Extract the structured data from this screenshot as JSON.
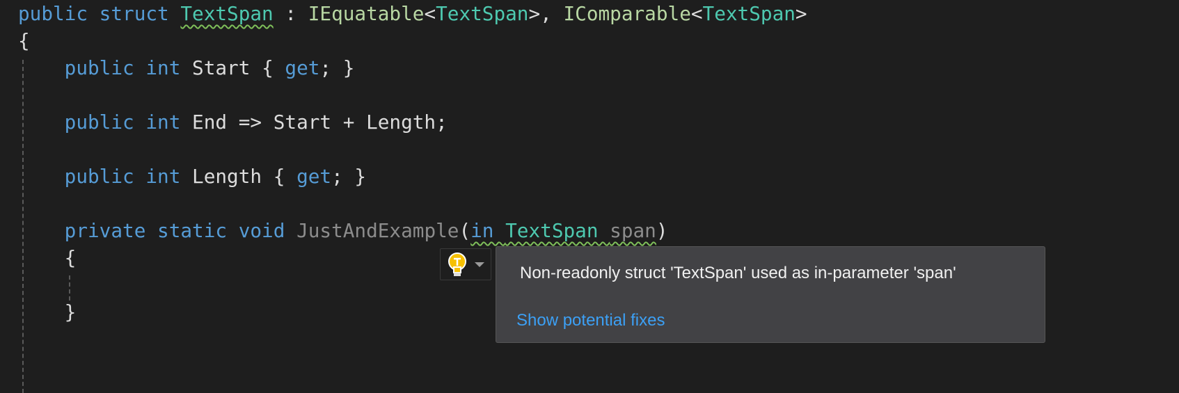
{
  "colors": {
    "background": "#1e1e1e",
    "keyword": "#569cd6",
    "type": "#4ec9b0",
    "interface": "#b8d7a3",
    "text": "#dcdcdc",
    "unused": "#8c8c8c",
    "squiggle": "#7fbf5a",
    "link": "#3ca0f5"
  },
  "code": {
    "lines": [
      [
        {
          "t": "public struct ",
          "c": "kw"
        },
        {
          "t": "TextSpan",
          "c": "ty sq"
        },
        {
          "t": " : ",
          "c": "tx"
        },
        {
          "t": "IEquatable",
          "c": "if"
        },
        {
          "t": "<",
          "c": "tx"
        },
        {
          "t": "TextSpan",
          "c": "ty"
        },
        {
          "t": ">, ",
          "c": "tx"
        },
        {
          "t": "IComparable",
          "c": "if"
        },
        {
          "t": "<",
          "c": "tx"
        },
        {
          "t": "TextSpan",
          "c": "ty"
        },
        {
          "t": ">",
          "c": "tx"
        }
      ],
      [
        {
          "t": "{",
          "c": "tx"
        }
      ],
      [
        {
          "t": "    public int ",
          "c": "kw"
        },
        {
          "t": "Start { ",
          "c": "tx"
        },
        {
          "t": "get",
          "c": "kw"
        },
        {
          "t": "; }",
          "c": "tx"
        }
      ],
      [],
      [
        {
          "t": "    public int ",
          "c": "kw"
        },
        {
          "t": "End => Start + Length;",
          "c": "tx"
        }
      ],
      [],
      [
        {
          "t": "    public int ",
          "c": "kw"
        },
        {
          "t": "Length { ",
          "c": "tx"
        },
        {
          "t": "get",
          "c": "kw"
        },
        {
          "t": "; }",
          "c": "tx"
        }
      ],
      [],
      [
        {
          "t": "    private static void ",
          "c": "kw"
        },
        {
          "t": "JustAndExample",
          "c": "dim"
        },
        {
          "t": "(",
          "c": "tx"
        },
        {
          "t": "in ",
          "c": "kw sq"
        },
        {
          "t": "TextSpan ",
          "c": "ty sq"
        },
        {
          "t": "span",
          "c": "dim sq"
        },
        {
          "t": ")",
          "c": "tx"
        }
      ],
      [
        {
          "t": "    {",
          "c": "tx"
        }
      ],
      [],
      [
        {
          "t": "    }",
          "c": "tx"
        }
      ]
    ]
  },
  "lightbulb": {
    "icon": "lightbulb-icon",
    "dropdown_icon": "chevron-down-icon"
  },
  "tooltip": {
    "message": "Non-readonly struct 'TextSpan' used as in-parameter 'span'",
    "link": "Show potential fixes"
  }
}
